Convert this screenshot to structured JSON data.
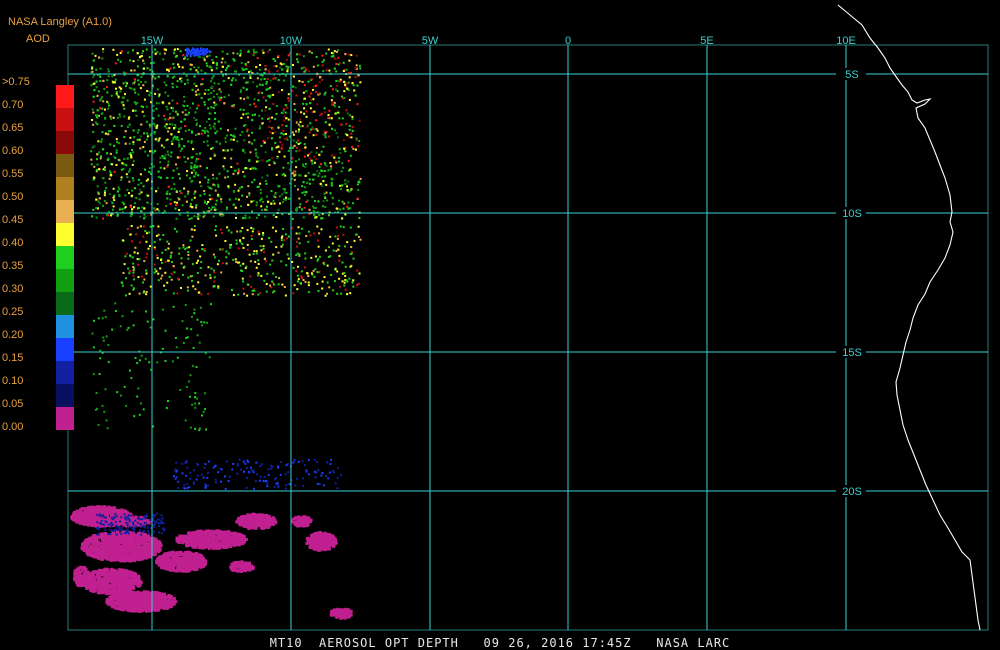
{
  "header": {
    "source": "NASA Langley (A1.0)",
    "product": "AOD"
  },
  "legend": {
    "labels": [
      ">0.75",
      "0.70",
      "0.65",
      "0.60",
      "0.55",
      "0.50",
      "0.45",
      "0.40",
      "0.35",
      "0.30",
      "0.25",
      "0.20",
      "0.15",
      "0.10",
      "0.05",
      "0.00"
    ],
    "colors": [
      "#ff1a1a",
      "#c81010",
      "#8a0a0a",
      "#7a5a10",
      "#b08020",
      "#e8b050",
      "#ffff30",
      "#20d020",
      "#10a010",
      "#0a6a1a",
      "#2090e0",
      "#1a40ff",
      "#1020a0",
      "#0a1060",
      "#c02090"
    ]
  },
  "map": {
    "lon_labels": [
      "15W",
      "10W",
      "5W",
      "0",
      "5E",
      "10E"
    ],
    "lat_labels": [
      "5S",
      "10S",
      "15S",
      "20S"
    ],
    "grid_color": "#3ad0d0",
    "coast_color": "#ffffff"
  },
  "footer": {
    "text": "MT10  AEROSOL OPT DEPTH   09 26, 2016 17:45Z   NASA LARC"
  }
}
